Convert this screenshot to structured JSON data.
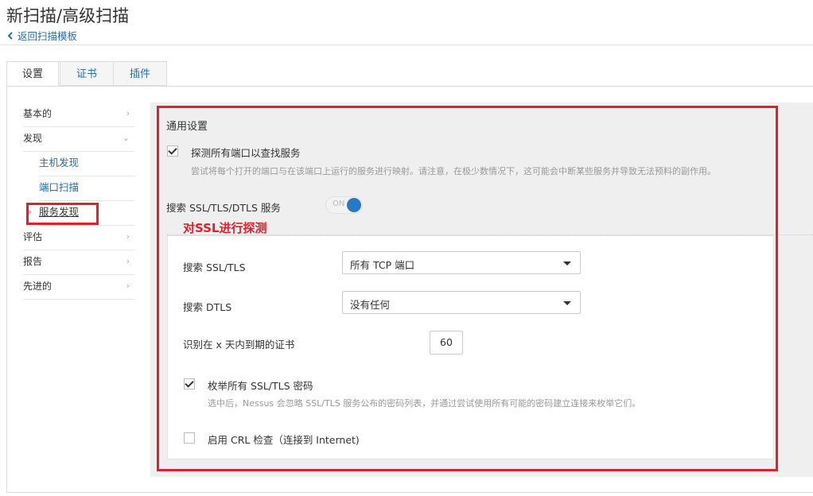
{
  "header": {
    "title": "新扫描/高级扫描",
    "back_link": "返回扫描模板"
  },
  "tabs": [
    {
      "label": "设置",
      "active": true
    },
    {
      "label": "证书",
      "active": false
    },
    {
      "label": "插件",
      "active": false
    }
  ],
  "sidebar": {
    "items": [
      {
        "label": "基本的",
        "arrow": "›"
      },
      {
        "label": "发现",
        "arrow": "⌄"
      },
      {
        "label": "评估",
        "arrow": "›"
      },
      {
        "label": "报告",
        "arrow": "›"
      },
      {
        "label": "先进的",
        "arrow": "›"
      }
    ],
    "sub_items": [
      {
        "label": "主机发现"
      },
      {
        "label": "端口扫描"
      },
      {
        "label": "服务发现",
        "active": true
      }
    ]
  },
  "main": {
    "section_title": "通用设置",
    "probe_all_ports": {
      "label": "探测所有端口以查找服务",
      "checked": true,
      "description": "尝试将每个打开的端口与在该端口上运行的服务进行映射。请注意，在极少数情况下，这可能会中断某些服务并导致无法预料的副作用。"
    },
    "ssl_search": {
      "label": "搜索 SSL/TLS/DTLS 服务",
      "toggle_text": "ON",
      "enabled": true
    },
    "annotation": "对SSL进行探测",
    "search_ssl_tls": {
      "label": "搜索 SSL/TLS",
      "value": "所有 TCP 端口"
    },
    "search_dtls": {
      "label": "搜索 DTLS",
      "value": "没有任何"
    },
    "cert_expiry": {
      "label": "识别在 x 天内到期的证书",
      "value": "60"
    },
    "enumerate_ciphers": {
      "label": "枚举所有 SSL/TLS 密码",
      "checked": true,
      "description": "选中后，Nessus 会忽略 SSL/TLS 服务公布的密码列表，并通过尝试使用所有可能的密码建立连接来枚举它们。"
    },
    "crl_check": {
      "label": "启用 CRL 检查（连接到 Internet)",
      "checked": false
    }
  },
  "colors": {
    "accent": "#2878c8",
    "link": "#2a6fa8",
    "annotation_red": "#e0202a"
  }
}
